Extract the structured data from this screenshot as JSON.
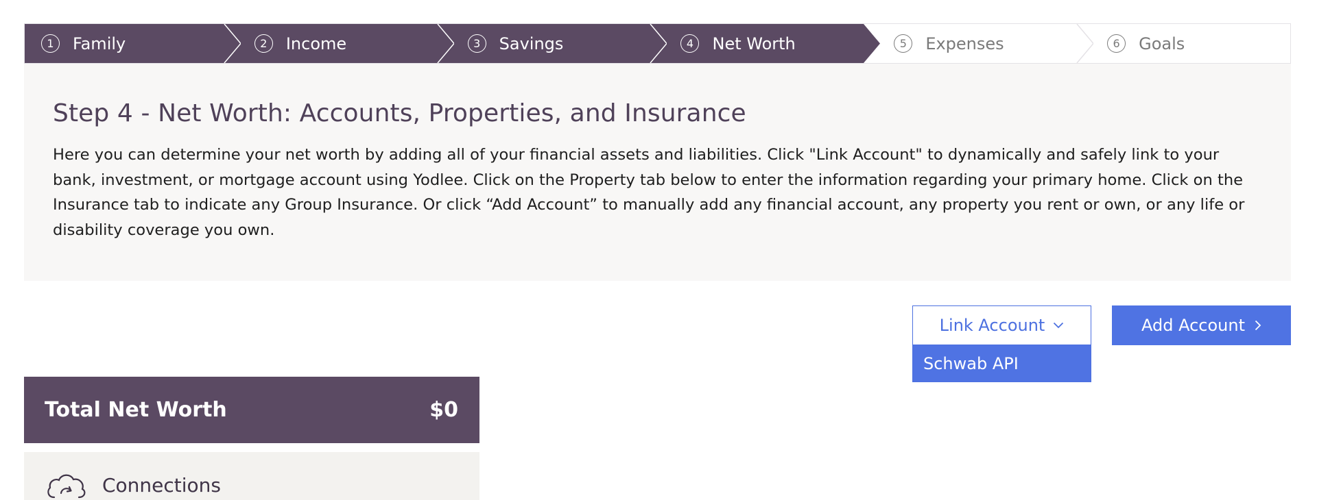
{
  "stepper": {
    "steps": [
      {
        "number": "1",
        "label": "Family",
        "state": "completed"
      },
      {
        "number": "2",
        "label": "Income",
        "state": "completed"
      },
      {
        "number": "3",
        "label": "Savings",
        "state": "completed"
      },
      {
        "number": "4",
        "label": "Net Worth",
        "state": "current"
      },
      {
        "number": "5",
        "label": "Expenses",
        "state": "upcoming"
      },
      {
        "number": "6",
        "label": "Goals",
        "state": "upcoming"
      }
    ]
  },
  "intro": {
    "title": "Step 4 - Net Worth: Accounts, Properties, and Insurance",
    "body": "Here you can determine your net worth by adding all of your financial assets and liabilities. Click \"Link Account\" to dynamically and safely link to your bank, investment, or mortgage account using Yodlee. Click on the Property tab below to enter the information regarding your primary home. Click on the Insurance tab to indicate any Group Insurance. Or click “Add Account” to manually add any financial account, any property you rent or own, or any life or disability coverage you own."
  },
  "actions": {
    "link_account_label": "Link Account",
    "add_account_label": "Add Account",
    "link_account_menu": {
      "expanded": true,
      "items": [
        {
          "label": "Schwab API",
          "highlighted": true
        }
      ]
    }
  },
  "summary": {
    "total_label": "Total Net Worth",
    "total_value": "$0"
  },
  "connections": {
    "label": "Connections",
    "icon": "cloud-sync-icon"
  },
  "colors": {
    "brand_purple": "#5b4a63",
    "title_purple": "#4f4159",
    "accent_blue": "#4f73e3",
    "panel_bg": "#f8f7f6",
    "inactive_text": "#7a7a7a"
  }
}
